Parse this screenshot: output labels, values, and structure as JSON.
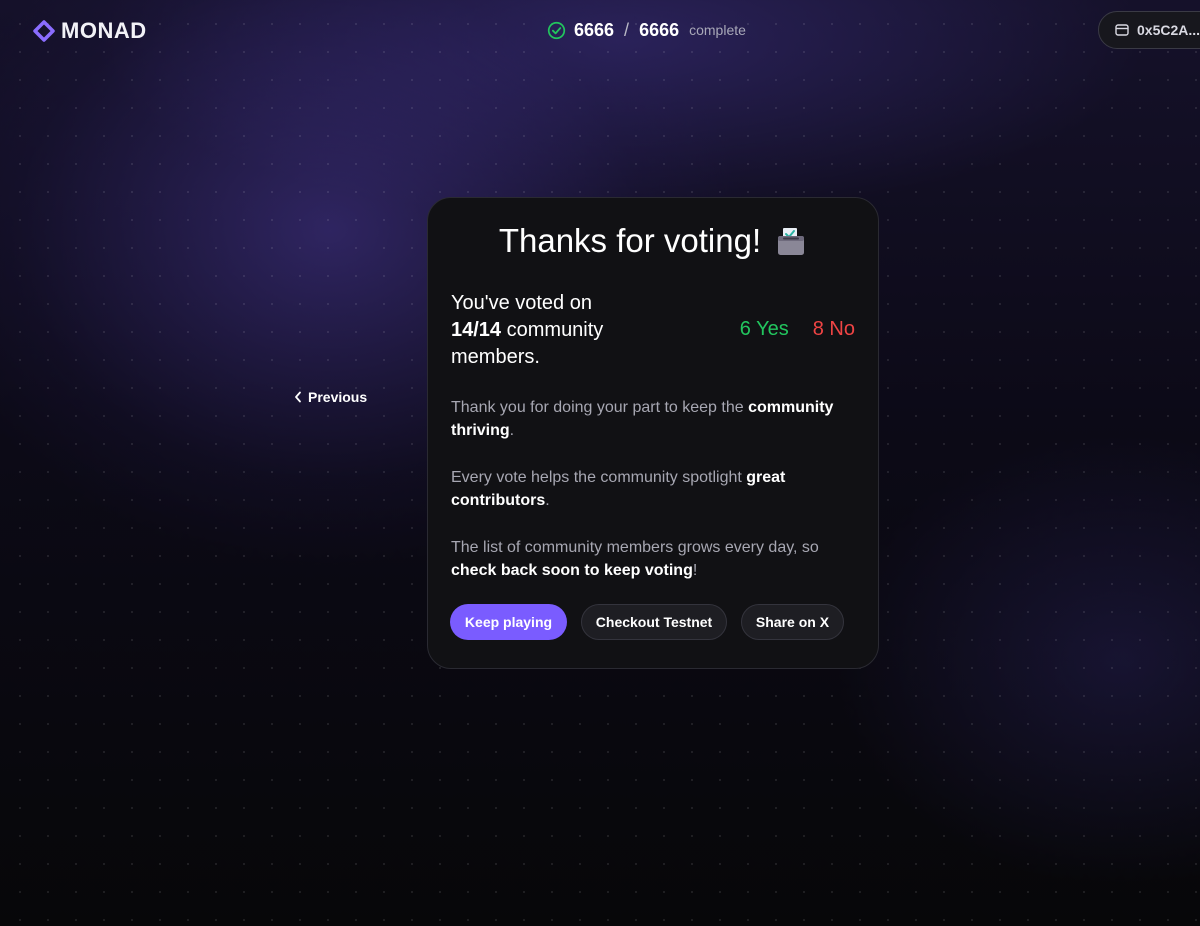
{
  "header": {
    "logo_text": "MONAD",
    "progress": {
      "done": "6666",
      "separator": "/",
      "total": "6666",
      "label": "complete"
    },
    "wallet_address": "0x5C2A..."
  },
  "nav": {
    "previous_label": "Previous"
  },
  "card": {
    "title": "Thanks for voting!",
    "voted_prefix": "You've voted on",
    "voted_count": "14/14",
    "voted_suffix": " community members.",
    "yes_label": "6 Yes",
    "no_label": "8 No",
    "p1_text": "Thank you for doing your part to keep the ",
    "p1_bold": "community thriving",
    "p1_end": ".",
    "p2_text": "Every vote helps the community spotlight ",
    "p2_bold": "great contributors",
    "p2_end": ".",
    "p3_text": "The list of community members grows every day, so ",
    "p3_bold": "check back soon to keep voting",
    "p3_end": "!",
    "buttons": {
      "keep_playing": "Keep playing",
      "checkout_testnet": "Checkout Testnet",
      "share_x": "Share on X"
    }
  },
  "icons": {
    "logo": "monad-logo-icon",
    "progress": "check-circle-icon",
    "wallet": "wallet-icon",
    "previous": "chevron-left-icon",
    "title": "ballot-box-icon"
  },
  "colors": {
    "accent": "#7a5cff",
    "yes": "#22c55e",
    "no": "#ef4444",
    "check": "#22c55e",
    "card_bg": "#111114"
  }
}
